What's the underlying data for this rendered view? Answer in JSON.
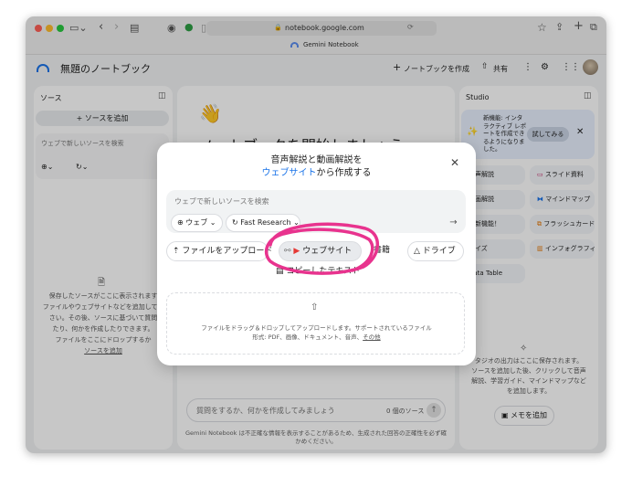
{
  "browser": {
    "url": "notebook.google.com",
    "tab_title": "Gemini Notebook"
  },
  "header": {
    "notebook_title": "無題のノートブック",
    "create_notebook_label": "ノートブックを作成",
    "share_label": "共有"
  },
  "sources": {
    "title": "ソース",
    "add_source_label": "ソースを追加",
    "search_placeholder": "ウェブで新しいソースを検索",
    "empty_lines": [
      "保存したソースがここに表示されます",
      "ファイルやウェブサイトなどを追加してく",
      "さい。その後、ソースに基づいて質問",
      "たり、何かを作成したりできます。",
      "ファイルをここにドロップするか"
    ],
    "import_link": "ソースを追加"
  },
  "chat": {
    "heading": "ノートブックを開始しましょう",
    "input_placeholder": "質問をするか、何かを作成してみましょう",
    "source_count": "0 個のソース",
    "disclaimer": "Gemini Notebook は不正確な情報を表示することがあるため、生成された回答の正確性を必ず確かめください。"
  },
  "studio": {
    "title": "Studio",
    "notice": {
      "text_lines": [
        "新機能: インタ",
        "ラクティブ レポ",
        "ートを作成でき",
        "るようになりま",
        "した。"
      ],
      "try_label": "試してみる"
    },
    "tiles": [
      {
        "label": "音声解説"
      },
      {
        "label": "スライド資料"
      },
      {
        "label": "動画解説"
      },
      {
        "label": "マインドマップ"
      },
      {
        "label": "レ新機能！"
      },
      {
        "label": "フラッシュカード"
      },
      {
        "label": "クイズ"
      },
      {
        "label": "インフォグラフィック"
      },
      {
        "label": "Data Table"
      }
    ],
    "empty_lines": [
      "タジオの出力はここに保存されます。",
      "ソースを追加した後、クリックして音声",
      "解説、学習ガイド、マインドマップなど",
      "を追加します。"
    ],
    "add_note_label": "メモを追加"
  },
  "modal": {
    "title_line1": "音声解説と動画解説を",
    "title_highlight": "ウェブサイト",
    "title_suffix": "から作成する",
    "search_placeholder": "ウェブで新しいソースを検索",
    "web_chip": "ウェブ",
    "research_chip": "Fast Research",
    "buttons": {
      "upload": "ファイルをアップロード",
      "website": "ウェブサイト",
      "books": "書籍",
      "drive": "ドライブ",
      "copied_text": "コピーしたテキスト"
    },
    "drop_text_line1": "ファイルをドラッグ＆ドロップしてアップロードします。サポートされているファイル",
    "drop_text_line2_prefix": "形式: PDF、画像、ドキュメント、音声、",
    "drop_text_more": "その他"
  },
  "colors": {
    "accent_blue": "#1a73e8",
    "annotation_pink": "#e8338e",
    "studio_notice_bg": "#e8f0fe"
  }
}
